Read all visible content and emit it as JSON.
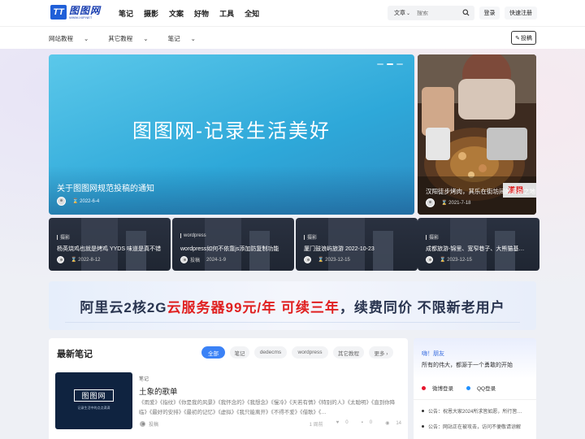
{
  "header": {
    "logo_mark": "TT",
    "logo_name": "图图网",
    "logo_url": "WWW.IXIP.NET",
    "nav": [
      "笔记",
      "摄影",
      "文案",
      "好物",
      "工具",
      "全知"
    ],
    "search_type": "文章",
    "search_placeholder": "搜索",
    "login": "登录",
    "register": "快速注册"
  },
  "subnav": {
    "items": [
      "网站教程",
      "其它教程",
      "笔记"
    ],
    "post_button": "投稿"
  },
  "hero": {
    "big_title": "图图网-记录生活美好",
    "caption": "关于图图网规范投稿的通知",
    "date": "2022-6-4"
  },
  "side_feature": {
    "caption": "汉阳徒步烤肉，其乐在街坊间的美食之地",
    "date": "2021-7-18",
    "sign": "漢陽"
  },
  "cards": [
    {
      "tag": "摄影",
      "title": "杨英烧鸡也就是烤鸡 YYDS 味道是真不错",
      "author": "",
      "date": "2022-8-12"
    },
    {
      "tag": "wordpress",
      "title": "wordpress如何不依靠js添加防复制功能",
      "author": "投稿",
      "date": "2024-1-9"
    },
    {
      "tag": "摄影",
      "title": "厦门鼓浪屿旅游 2022-10-23",
      "author": "",
      "date": "2023-12-15"
    },
    {
      "tag": "摄影",
      "title": "成都旅游-锦里、宽窄巷子、大熊猫基…",
      "author": "",
      "date": "2023-12-15"
    }
  ],
  "banner": {
    "part1": "阿里云2核2G",
    "part2": "云服务器99元/年 可续三年",
    "part3": "，续费同价 不限新老用户"
  },
  "notes": {
    "title": "最新笔记",
    "filters": [
      "全部",
      "笔记",
      "dedecms",
      "wordpress",
      "其它教程",
      "更多 ›"
    ],
    "post": {
      "thumb_title": "图图网",
      "thumb_sub": "记录生活中的点点滴滴",
      "tag": "笔记",
      "title": "土象的歌单",
      "desc": "《雨爱》《指纹》《你是我的风景》《我怀念的》《我想念》《慢冷》《天若有情》《特别的人》《太聪明》《直到你降临》《最好的安排》《最初的记忆》《虚拟》《我只能离开》《不得不爱》《借歌》《…",
      "author": "投稿",
      "stats": [
        "1 周前",
        "0",
        "0",
        "14"
      ]
    }
  },
  "side": {
    "greeting": "嗨！朋友",
    "subtitle": "所有的伟大，都源于一个勇敢的开始",
    "login_weibo": "微博登录",
    "login_qq": "QQ登录",
    "items": [
      "公告：祝恩大家2024所求皆如愿，所行皆…",
      "公告：网站正在被攻击，访问不便敬请谅解"
    ]
  }
}
